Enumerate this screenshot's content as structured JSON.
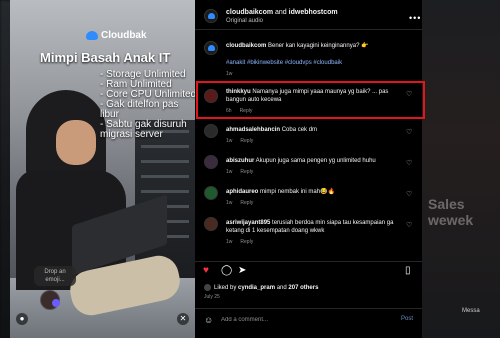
{
  "video": {
    "brand": "Cloudbak",
    "title": "Mimpi Basah Anak IT",
    "features": [
      "- Storage Unlimited",
      "- Ram Unlimited",
      "- Core CPU Unlimited",
      "- Gak ditelfon pas",
      "libur",
      "- Sabtu gak disuruh",
      "migrasi server"
    ],
    "drop_emoji": "Drop an emoji..."
  },
  "header": {
    "author_1": "cloudbaikcom",
    "connector": " and ",
    "author_2": "idwebhostcom",
    "audio": "Original audio"
  },
  "caption": {
    "author": "cloudbaikcom",
    "text": " Bener kan kayagini keinginannya? 👉",
    "hashtags": "#anakit #bikinwebsite #cloudvps #cloudbaik",
    "time": "1w"
  },
  "comments": [
    {
      "author": "thinkkyu",
      "text": " Namanya juga mimpi yaaa maunya yg baik? ... pas bangun auto kecewa",
      "time": "6h",
      "reply": "Reply"
    },
    {
      "author": "ahmadsalehbancin",
      "text": " Coba cek dm",
      "time": "1w",
      "reply": "Reply"
    },
    {
      "author": "abiszuhur",
      "text": " Akupun juga sama pengen yg unlimited huhu",
      "time": "1w",
      "reply": "Reply"
    },
    {
      "author": "aphidaureo",
      "text": " mimpi nembak ini mah😂🔥",
      "time": "1w",
      "reply": "Reply"
    },
    {
      "author": "asriwijayant895",
      "text": " terusiah berdoa min siapa tau kesampaian ga ketang di 1 kesempatan doang wkwk",
      "time": "1w",
      "reply": "Reply"
    }
  ],
  "likes": {
    "prefix": "Liked by ",
    "user": "cyndia_pram",
    "middle": " and ",
    "others": "207 others"
  },
  "date": "July 25",
  "add_comment": {
    "placeholder": "Add a comment...",
    "post": "Post"
  },
  "backdrop": {
    "sales": "Sales\nwewek",
    "message": "Messa"
  },
  "colors": {
    "highlight": "#e0161b",
    "like": "#ff3040",
    "link": "#8db8ff",
    "brand": "#2f8cff"
  },
  "icons": [
    "more-icon",
    "heart-icon",
    "comment-icon",
    "share-icon",
    "bookmark-icon",
    "emoji-icon"
  ]
}
